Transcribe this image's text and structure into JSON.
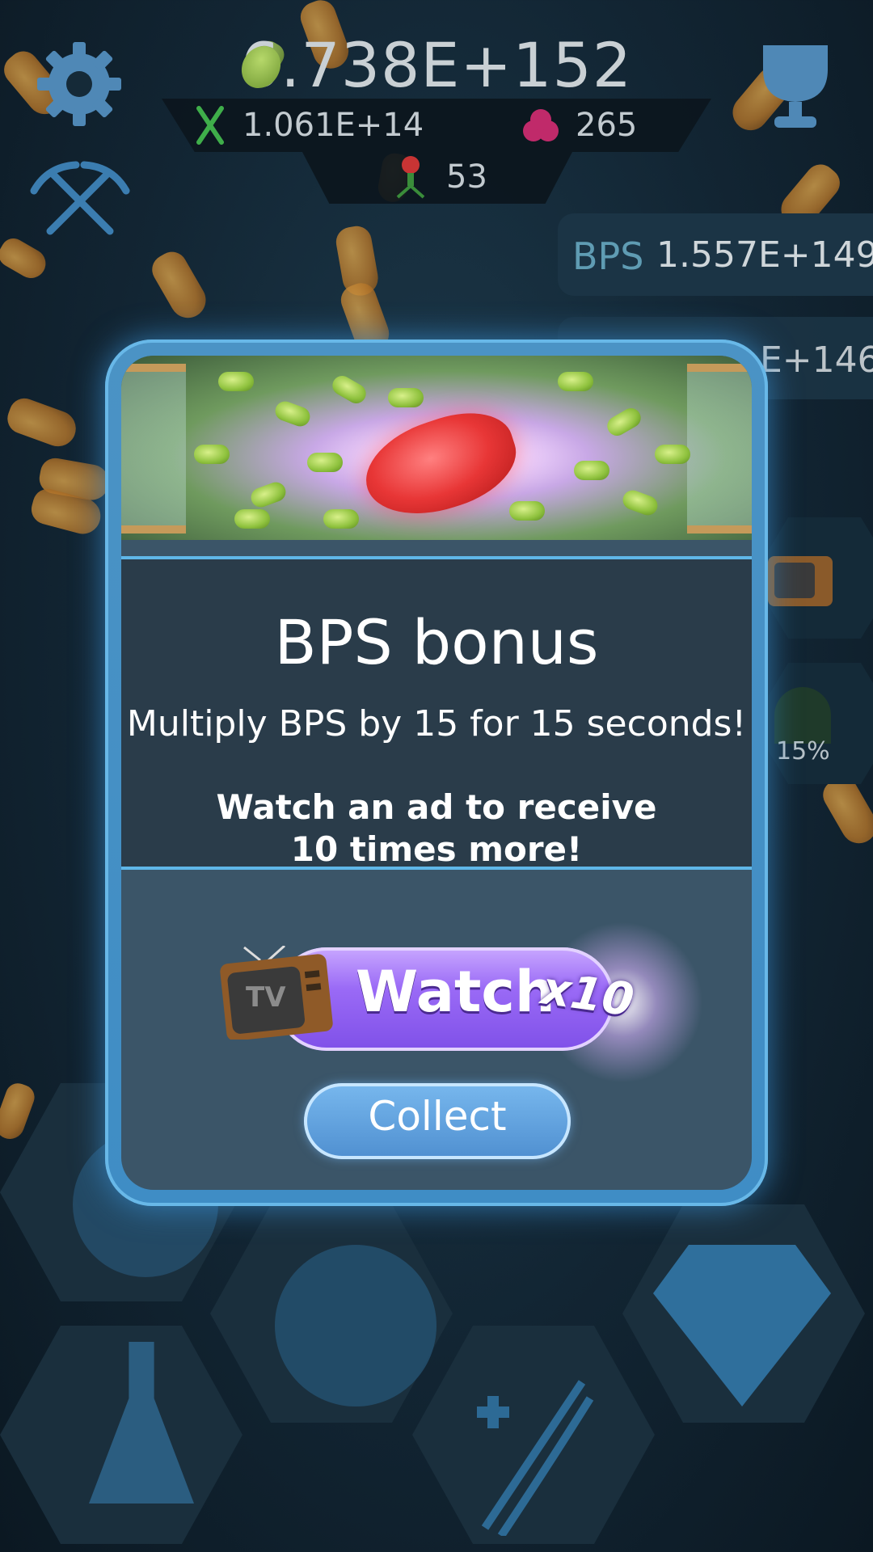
{
  "hud": {
    "main_count": "6.738E+152",
    "dna_count": "1.061E+14",
    "gem_count": "265",
    "virus_count": "53"
  },
  "side": {
    "bps_label": "BPS",
    "bps_value": "1.557E+149",
    "second_value_partial": "E+146",
    "progress_label": "15%"
  },
  "modal": {
    "title": "BPS bonus",
    "description": "Multiply BPS by 15 for 15 seconds!",
    "ad_line1": "Watch an ad to receive",
    "ad_line2": "10 times more!",
    "watch_label": "Watch",
    "watch_multiplier": "x10",
    "tv_text": "TV",
    "collect_label": "Collect"
  },
  "icons": [
    "gear-icon",
    "pickaxes-icon",
    "trophy-icon",
    "dna-icon",
    "gem-icon",
    "virus-icon",
    "tv-icon",
    "flask-icon",
    "dna-upgrade-icon",
    "diamond-icon"
  ],
  "colors": {
    "modal_border": "#4b93c5",
    "watch_button": "#9a6af6",
    "collect_button": "#5f9fdc",
    "background": "#122533"
  }
}
